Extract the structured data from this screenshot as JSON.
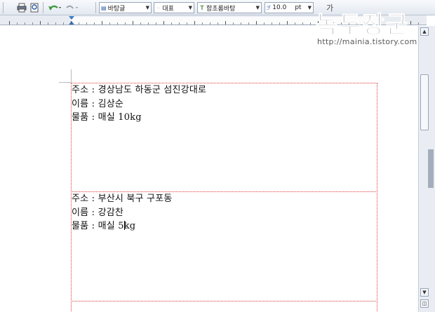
{
  "toolbar": {
    "style_combo": "바탕글",
    "language_combo": "대표",
    "font_combo": "함초롬바탕",
    "font_size": "10.0",
    "size_unit": "pt",
    "font_size_icon": "가"
  },
  "document": {
    "labels": [
      {
        "address": "주소 : 경상남도 하동군 섬진강대로",
        "name": "이름 : 김상순",
        "item": "물품 : 매실 10kg"
      },
      {
        "address": "주소 : 부산시 북구 구포동",
        "name": "이름 : 강감찬",
        "item_before_cursor": "물품 : 매실 5",
        "item_after_cursor": "kg"
      }
    ]
  },
  "watermark": {
    "title": "녹두장군",
    "url": "http://mainia.tistory.com"
  },
  "icons": [
    "print-icon",
    "print-preview-icon",
    "undo-icon",
    "redo-icon",
    "style-icon",
    "language-icon",
    "font-icon",
    "font-size-icon",
    "scroll-up-icon",
    "scroll-down-icon"
  ],
  "colors": {
    "label_border": "#e03a3a",
    "toolbar_bg": "#e3e8f0"
  }
}
